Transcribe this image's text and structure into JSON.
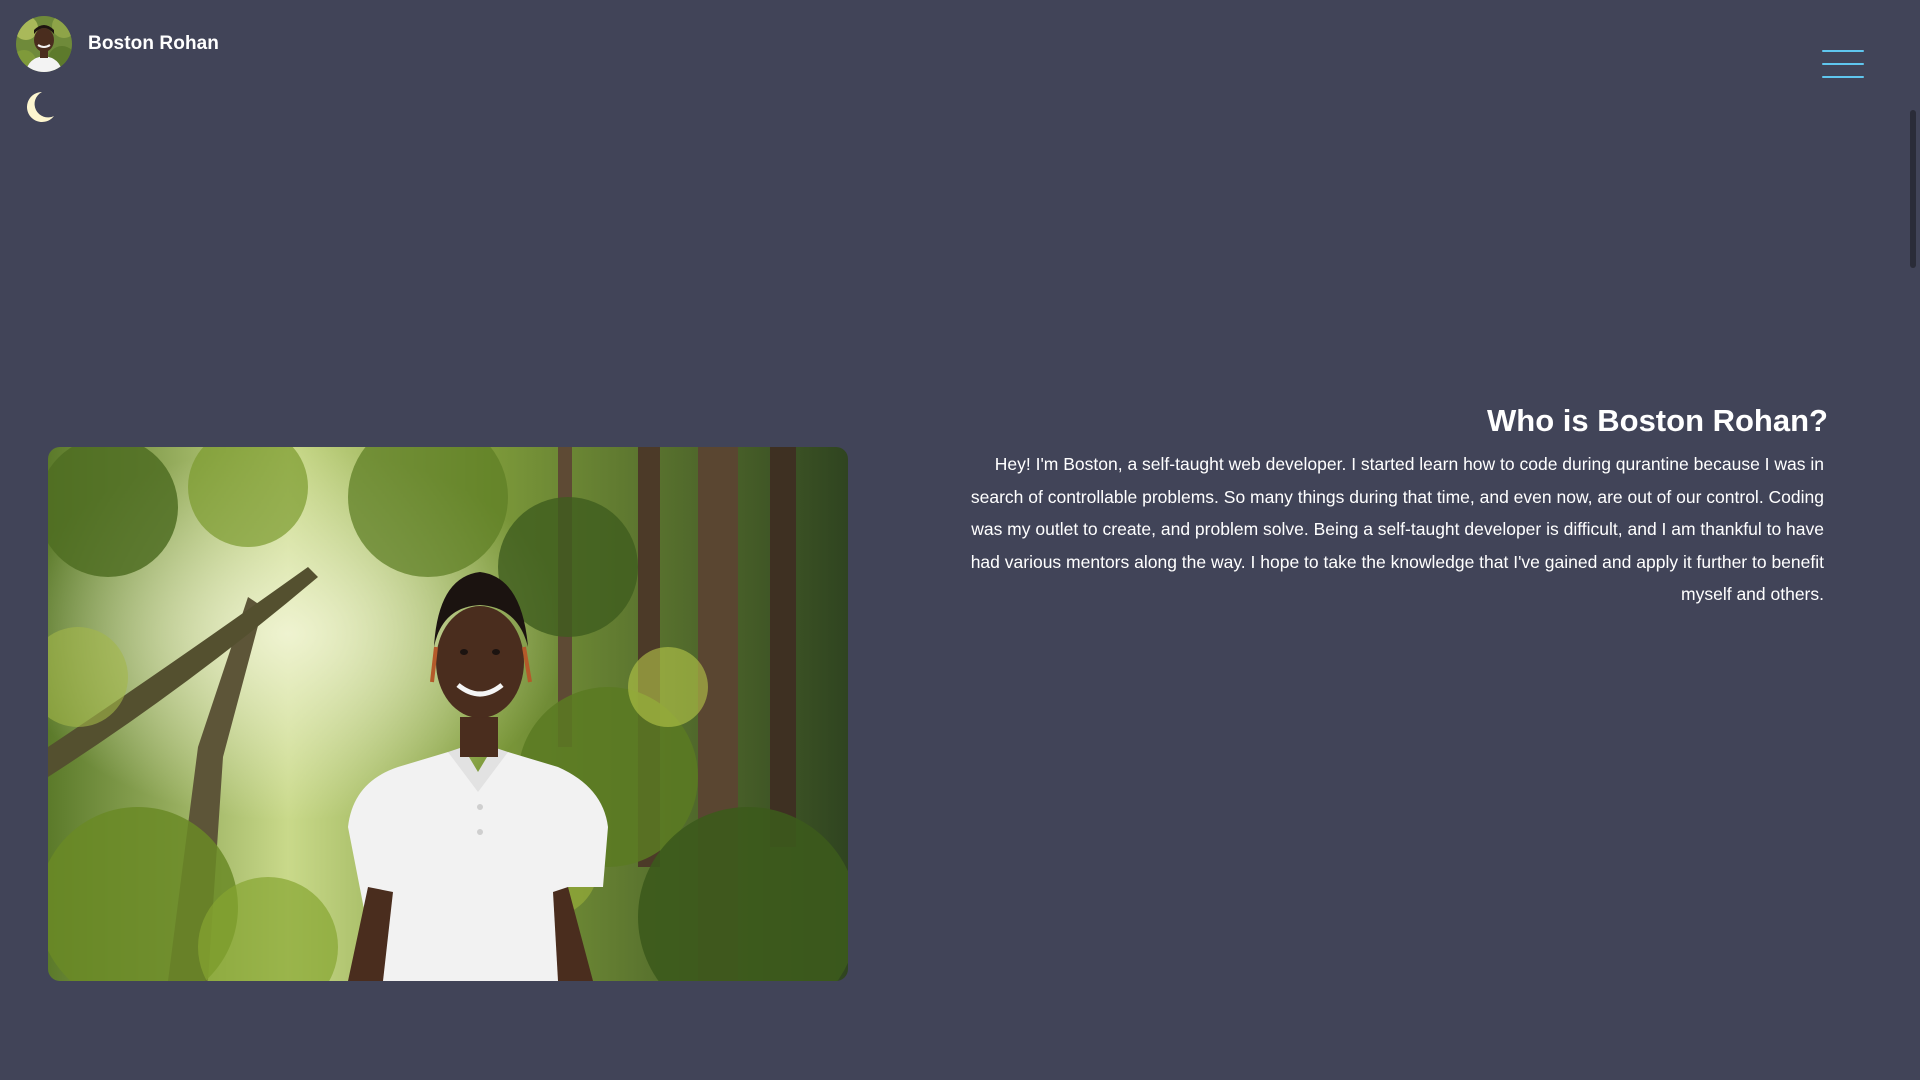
{
  "brand": {
    "name": "Boston Rohan",
    "avatar_icon": "avatar-photo"
  },
  "theme_toggle": {
    "icon": "moon-icon",
    "color": "#fdf6cf"
  },
  "menu": {
    "icon": "hamburger-menu-icon",
    "color": "#5fc6ee"
  },
  "about": {
    "heading": "Who is Boston Rohan?",
    "body": "Hey! I'm Boston, a self-taught web developer. I started learn how to code during qurantine because I was in search of controllable problems. So many things during that time, and even now, are out of our control. Coding was my outlet to create, and problem solve. Being a self-taught developer is difficult, and I am thankful to have had various mentors along the way. I hope to take the knowledge that I've gained and apply it further to benefit myself and others.",
    "photo": "portrait-photo-forest"
  },
  "colors": {
    "background": "#414458",
    "text": "#ffffff",
    "accent": "#5fc6ee"
  }
}
